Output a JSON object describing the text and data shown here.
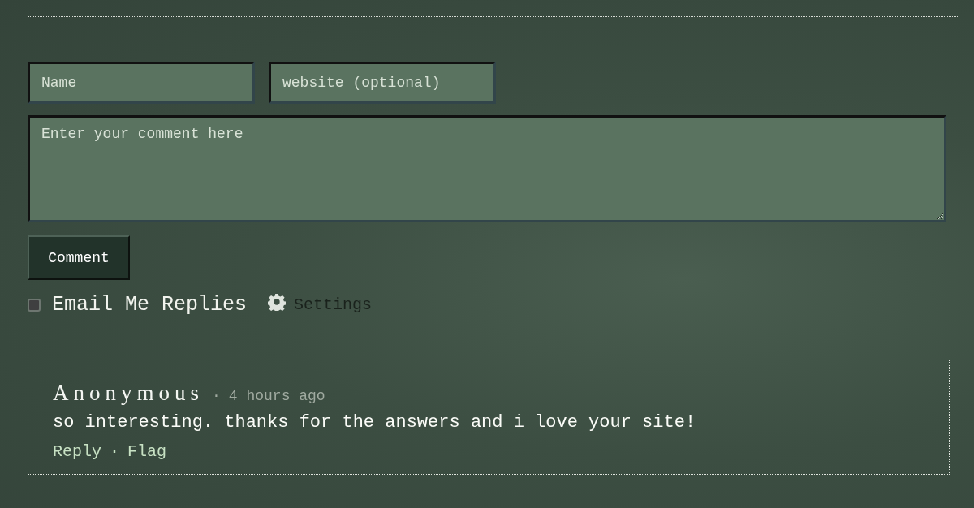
{
  "form": {
    "name_field": {
      "placeholder": "Name"
    },
    "website_field": {
      "placeholder": "website (optional)"
    },
    "comment_field": {
      "placeholder": "Enter your comment here"
    },
    "submit_button": "Comment",
    "email_replies": {
      "label": "Email Me Replies",
      "checked": false
    },
    "settings_link": "Settings"
  },
  "comments": [
    {
      "author": "Anonymous",
      "meta_separator": "·",
      "time": "4 hours ago",
      "text": "so interesting. thanks for the answers and i love your site!",
      "actions": [
        "Reply",
        "Flag"
      ],
      "action_separator": "·"
    }
  ]
}
